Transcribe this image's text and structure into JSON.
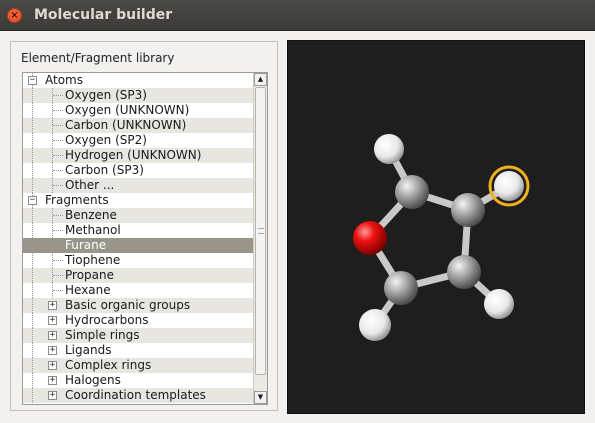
{
  "window": {
    "title": "Molecular builder",
    "close_glyph": "×"
  },
  "library": {
    "label": "Element/Fragment library",
    "rows": [
      {
        "text": "Atoms",
        "level": 0,
        "expander": "−"
      },
      {
        "text": "Oxygen (SP3)",
        "level": 1
      },
      {
        "text": "Oxygen (UNKNOWN)",
        "level": 1
      },
      {
        "text": "Carbon (UNKNOWN)",
        "level": 1
      },
      {
        "text": "Oxygen (SP2)",
        "level": 1
      },
      {
        "text": "Hydrogen (UNKNOWN)",
        "level": 1
      },
      {
        "text": "Carbon (SP3)",
        "level": 1
      },
      {
        "text": "Other ...",
        "level": 1
      },
      {
        "text": "Fragments",
        "level": 0,
        "expander": "−"
      },
      {
        "text": "Benzene",
        "level": 1
      },
      {
        "text": "Methanol",
        "level": 1
      },
      {
        "text": "Furane",
        "level": 1,
        "selected": true
      },
      {
        "text": "Tiophene",
        "level": 1
      },
      {
        "text": "Propane",
        "level": 1
      },
      {
        "text": "Hexane",
        "level": 1
      },
      {
        "text": "Basic organic groups",
        "level": 1,
        "expander": "+"
      },
      {
        "text": "Hydrocarbons",
        "level": 1,
        "expander": "+"
      },
      {
        "text": "Simple rings",
        "level": 1,
        "expander": "+"
      },
      {
        "text": "Ligands",
        "level": 1,
        "expander": "+"
      },
      {
        "text": "Complex rings",
        "level": 1,
        "expander": "+"
      },
      {
        "text": "Halogens",
        "level": 1,
        "expander": "+"
      },
      {
        "text": "Coordination templates",
        "level": 1,
        "expander": "+"
      }
    ],
    "scroll_up_glyph": "▲",
    "scroll_down_glyph": "▼"
  },
  "viewer": {
    "background": "#1e1e1e",
    "colors": {
      "carbon": "#9a9a9a",
      "oxygen": "#e01010",
      "hydrogen": "#f2f2f2",
      "bond": "#bdbdbd",
      "selection": "#f0b020"
    }
  }
}
